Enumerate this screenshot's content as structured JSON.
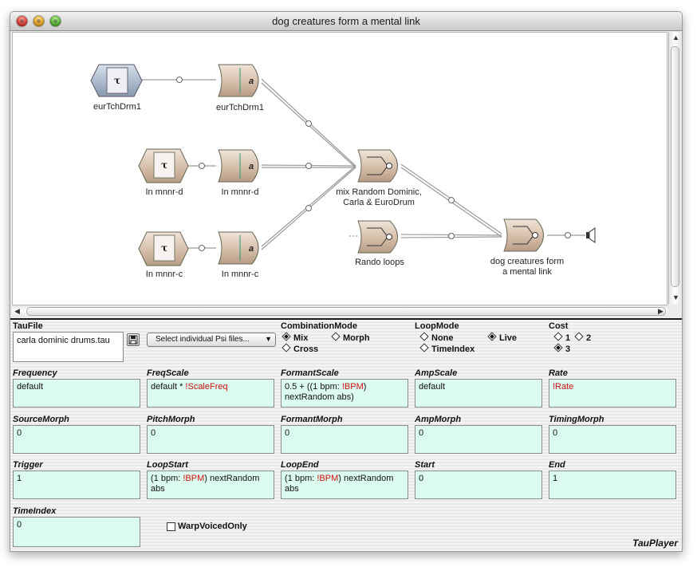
{
  "window": {
    "title": "dog creatures form a mental link"
  },
  "graph": {
    "nodes": [
      {
        "label": "eurTchDrm1"
      },
      {
        "label": "eurTchDrm1"
      },
      {
        "label": "In  mnnr-d"
      },
      {
        "label": "In  mnnr-d"
      },
      {
        "label": "In  mnnr-c"
      },
      {
        "label": "In  mnnr-c"
      },
      {
        "label": "mix Random Dominic,\nCarla & EuroDrum"
      },
      {
        "label": "Rando loops"
      },
      {
        "label": "dog creatures form\na mental link"
      }
    ]
  },
  "panel": {
    "taufile": {
      "label": "TauFile",
      "value": "carla dominic drums.tau"
    },
    "psi_popup": "Select individual Psi files...",
    "combination": {
      "label": "CombinationMode",
      "options": [
        "Mix",
        "Morph",
        "Cross"
      ],
      "selected": "Mix"
    },
    "loop": {
      "label": "LoopMode",
      "options": [
        "None",
        "Live",
        "TimeIndex"
      ],
      "selected": "Live"
    },
    "cost": {
      "label": "Cost",
      "options": [
        "1",
        "2",
        "3"
      ],
      "selected": "3"
    },
    "fields": [
      {
        "label": "Frequency",
        "value": "default"
      },
      {
        "label": "FreqScale",
        "value": "default * ",
        "red": "!ScaleFreq"
      },
      {
        "label": "FormantScale",
        "line1": "0.5 + ((1 bpm: ",
        "red": "!BPM",
        "line1b": ")",
        "line2": "nextRandom abs)"
      },
      {
        "label": "AmpScale",
        "value": "default"
      },
      {
        "label": "Rate",
        "red": "!Rate"
      },
      {
        "label": "SourceMorph",
        "value": "0"
      },
      {
        "label": "PitchMorph",
        "value": "0"
      },
      {
        "label": "FormantMorph",
        "value": "0"
      },
      {
        "label": "AmpMorph",
        "value": "0"
      },
      {
        "label": "TimingMorph",
        "value": "0"
      },
      {
        "label": "Trigger",
        "value": "1"
      },
      {
        "label": "LoopStart",
        "line1": "(1 bpm: ",
        "red": "!BPM",
        "line1b": ") nextRandom",
        "line2": "abs"
      },
      {
        "label": "LoopEnd",
        "line1": "(1 bpm: ",
        "red": "!BPM",
        "line1b": ") nextRandom",
        "line2": "abs"
      },
      {
        "label": "Start",
        "value": "0"
      },
      {
        "label": "End",
        "value": "1"
      },
      {
        "label": "TimeIndex",
        "value": "0"
      }
    ],
    "warp": "WarpVoicedOnly",
    "brand": "TauPlayer"
  },
  "colors": {
    "field_bg": "#dbfbef",
    "accent_red": "#d01010",
    "node_tan": "#d9c6b4"
  }
}
